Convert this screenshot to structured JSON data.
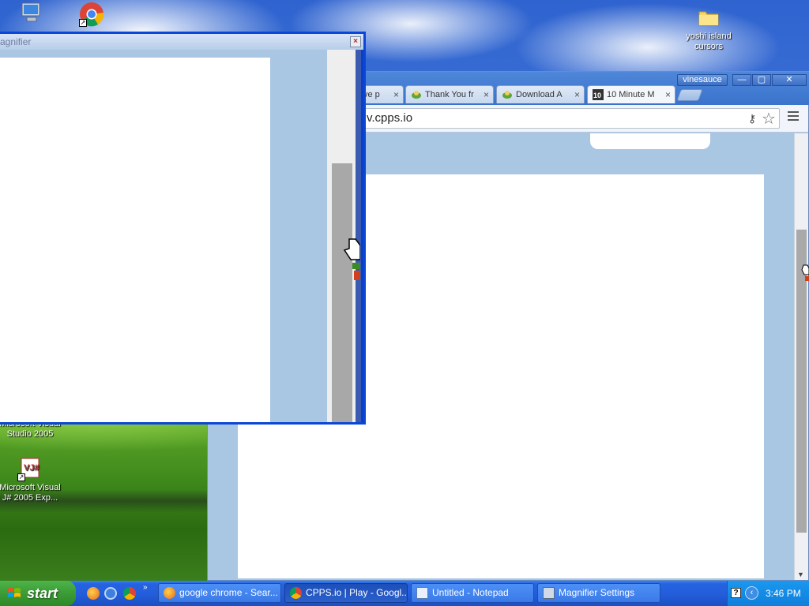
{
  "desktop": {
    "icons": [
      {
        "label": "",
        "icon": "my-computer-icon"
      },
      {
        "label": "",
        "icon": "google-chrome-icon"
      },
      {
        "label": "yoshi island cursors",
        "icon": "folder-icon"
      },
      {
        "label": "Microsoft Visual Studio 2005",
        "icon": "visual-studio-icon"
      },
      {
        "label": "Microsoft Visual J# 2005 Exp...",
        "icon": "visual-jsharp-icon"
      }
    ]
  },
  "magnifier": {
    "title": "agnifier",
    "close_label": "×"
  },
  "chrome": {
    "profile_name": "vinesauce",
    "window_buttons": {
      "minimize": "—",
      "maximize": "▢",
      "close": "✕"
    },
    "tabs": [
      {
        "label": "ve p",
        "icon": "cpps-favicon"
      },
      {
        "label": "Thank You fr",
        "icon": "turtle-favicon"
      },
      {
        "label": "Download A",
        "icon": "turtle-favicon"
      },
      {
        "label": "10 Minute M",
        "icon": "ten-minute-mail-favicon"
      }
    ],
    "tab_close": "×",
    "omnibox_url": "v.cpps.io",
    "colors": {
      "page_bg": "#a9c6e3",
      "frame": "#3a73cc"
    }
  },
  "taskbar": {
    "start_label": "start",
    "quick_launch_more": "»",
    "tasks": [
      {
        "label": "google chrome - Sear...",
        "icon": "firefox-icon",
        "active": false
      },
      {
        "label": "CPPS.io | Play - Googl...",
        "icon": "chrome-icon",
        "active": true
      },
      {
        "label": "Untitled - Notepad",
        "icon": "notepad-icon",
        "active": false
      },
      {
        "label": "Magnifier Settings",
        "icon": "magnifier-icon",
        "active": false
      }
    ],
    "tray_help": "?",
    "tray_arrow": "‹",
    "clock": "3:46 PM"
  }
}
